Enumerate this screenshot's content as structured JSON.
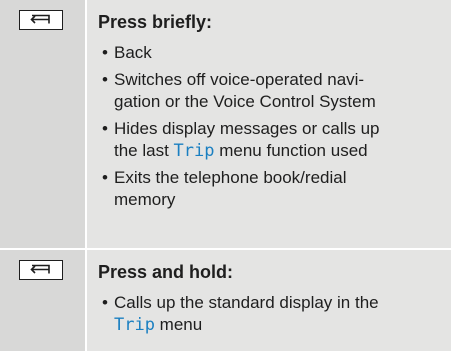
{
  "rows": [
    {
      "key_icon": "back-arrow-icon",
      "heading": "Press briefly:",
      "items": [
        {
          "text": "Back"
        },
        {
          "line1": "Switches off voice-operated navi-",
          "line2": "gation or the Voice Control System"
        },
        {
          "line1": "Hides display messages or calls up",
          "pre2": "the last ",
          "menu": "Trip",
          "post2": " menu function used"
        },
        {
          "line1": "Exits the telephone book/redial",
          "line2": "memory"
        }
      ]
    },
    {
      "key_icon": "back-arrow-icon",
      "heading": "Press and hold:",
      "items": [
        {
          "line1": "Calls up the standard display in the",
          "menu": "Trip",
          "post2": " menu"
        }
      ]
    }
  ],
  "colors": {
    "menu_term": "#1a7fc1",
    "row_bg": "#e4e4e3",
    "key_col_bg": "#d8d8d7"
  }
}
